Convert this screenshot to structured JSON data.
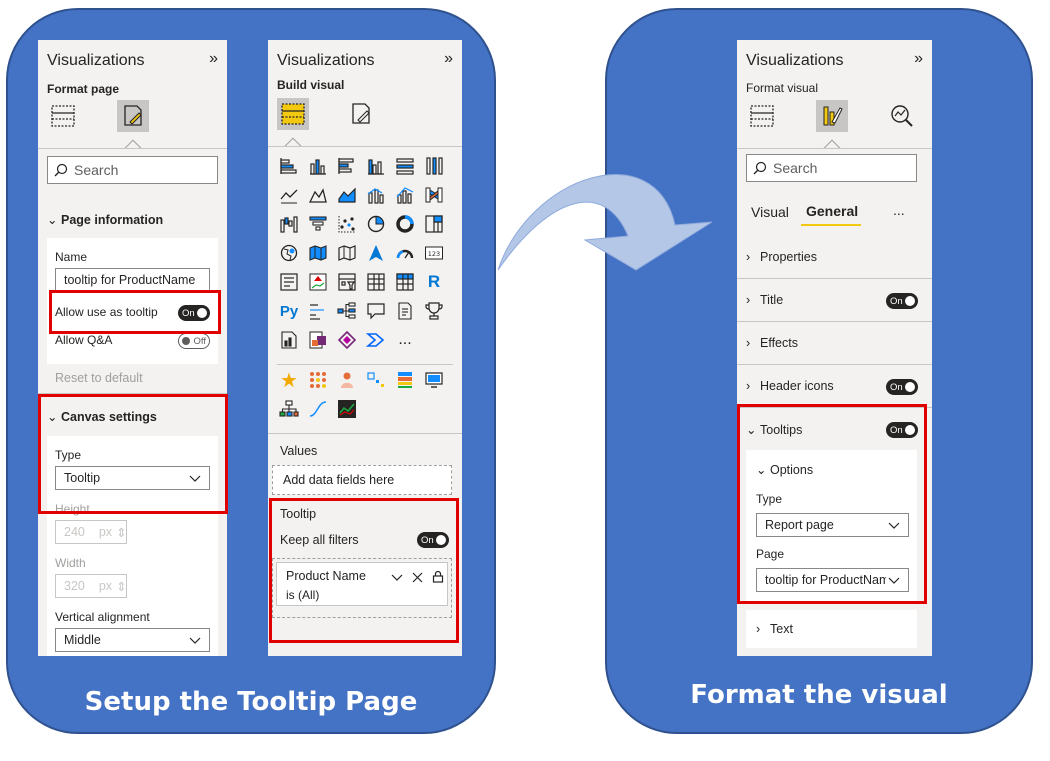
{
  "captions": {
    "left": "Setup the Tooltip Page",
    "right": "Format the visual"
  },
  "panel_format_page": {
    "title": "Visualizations",
    "expand_icon": "double-chevron-right-icon",
    "subtitle": "Format page",
    "search_placeholder": "Search",
    "page_information": {
      "header": "Page information",
      "name_label": "Name",
      "name_value": "tooltip for ProductName",
      "allow_tooltip_label": "Allow use as tooltip",
      "allow_tooltip_state": "On",
      "allow_qa_label": "Allow Q&A",
      "allow_qa_state": "Off"
    },
    "reset_label": "Reset to default",
    "canvas_settings": {
      "header": "Canvas settings",
      "type_label": "Type",
      "type_value": "Tooltip",
      "height_label": "Height",
      "height_value": "240",
      "width_label": "Width",
      "width_value": "320",
      "unit": "px",
      "valign_label": "Vertical alignment",
      "valign_value": "Middle"
    }
  },
  "panel_build_visual": {
    "title": "Visualizations",
    "subtitle": "Build visual",
    "visual_icons": [
      "stacked-bar-icon",
      "stacked-column-icon",
      "clustered-bar-icon",
      "clustered-column-icon",
      "100-bar-icon",
      "100-column-icon",
      "line-chart-icon",
      "area-chart-icon",
      "stacked-area-icon",
      "line-column-icon",
      "line-clustered-icon",
      "ribbon-chart-icon",
      "waterfall-icon",
      "funnel-icon",
      "scatter-icon",
      "pie-chart-icon",
      "donut-chart-icon",
      "treemap-icon",
      "map-icon",
      "filled-map-icon",
      "shape-map-icon",
      "azure-map-icon",
      "gauge-icon",
      "card-icon",
      "multirow-card-icon",
      "kpi-icon",
      "slicer-icon",
      "table-icon",
      "matrix-icon",
      "r-visual-icon",
      "python-visual-icon",
      "key-influencers-icon",
      "decomposition-tree-icon",
      "qa-icon",
      "smart-narrative-icon",
      "goals-icon",
      "paginated-report-icon",
      "power-apps-icon",
      "power-automate-icon",
      "more-icon"
    ],
    "custom_icons": [
      "star-visual-icon",
      "dot-grid-visual-icon",
      "person-visual-icon",
      "scatter-custom-icon",
      "heatmap-custom-icon",
      "monitor-custom-icon",
      "org-chart-icon",
      "s-curve-icon",
      "dark-line-icon"
    ],
    "more_glyph": "...",
    "r_glyph": "R",
    "py_glyph": "Py",
    "card_glyph": "123",
    "values_label": "Values",
    "add_fields": "Add data fields here",
    "tooltip_header": "Tooltip",
    "keep_filters_label": "Keep all filters",
    "keep_filters_state": "On",
    "filter_field": "Product Name",
    "filter_value": "is (All)"
  },
  "panel_format_visual": {
    "title": "Visualizations",
    "subtitle": "Format visual",
    "search_placeholder": "Search",
    "tabs": [
      "Visual",
      "General"
    ],
    "more": "...",
    "sections": [
      {
        "label": "Properties",
        "toggle": null
      },
      {
        "label": "Title",
        "toggle": "On"
      },
      {
        "label": "Effects",
        "toggle": null
      },
      {
        "label": "Header icons",
        "toggle": "On"
      }
    ],
    "tooltips": {
      "label": "Tooltips",
      "toggle": "On",
      "options_label": "Options",
      "type_label": "Type",
      "type_value": "Report page",
      "page_label": "Page",
      "page_value": "tooltip for ProductName"
    },
    "text_section": "Text"
  },
  "colors": {
    "blob": "#4472c4",
    "highlight": "#e00000",
    "pane": "#f3f2f1",
    "accent": "#f2c811"
  }
}
